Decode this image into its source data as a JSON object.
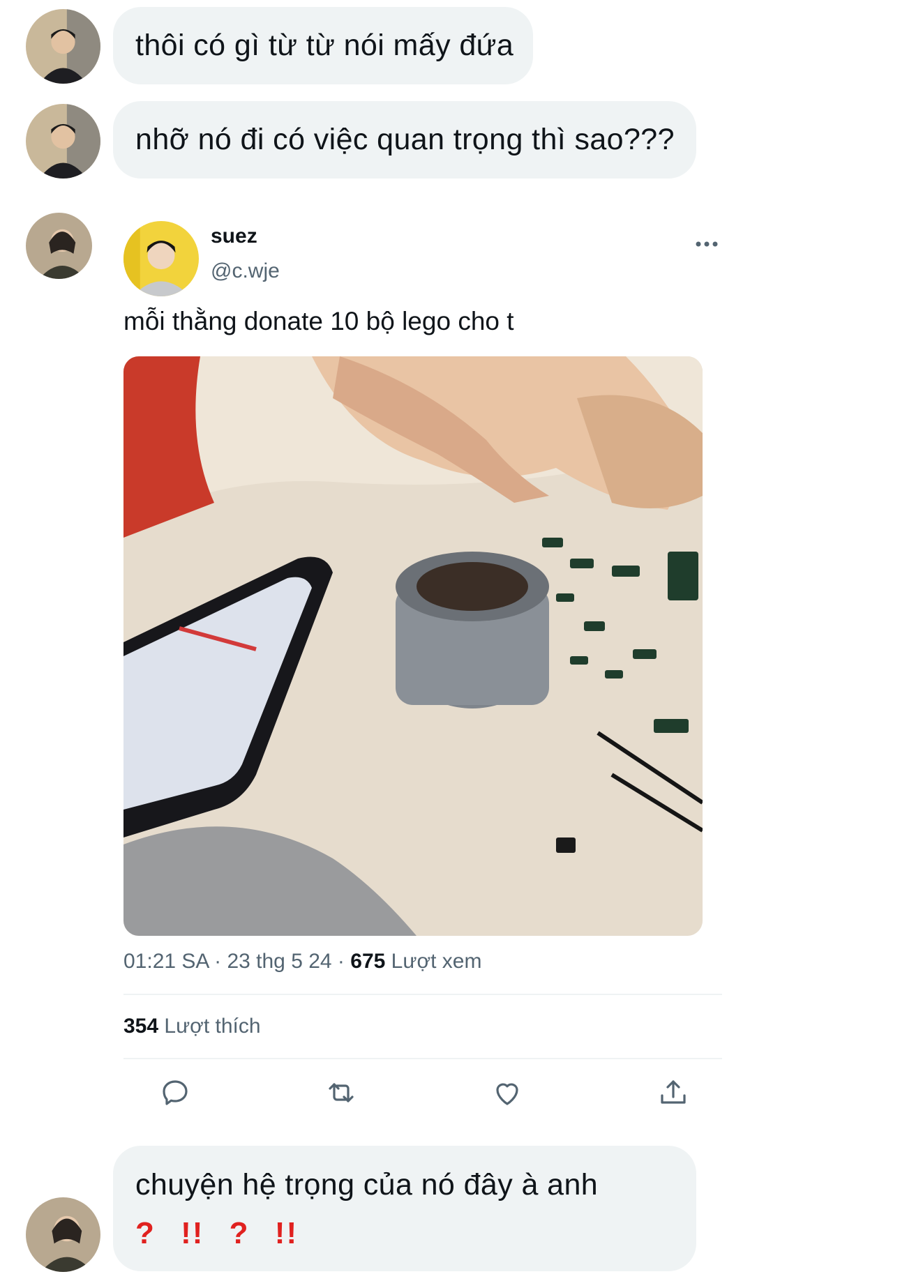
{
  "messages": [
    {
      "text": "thôi có gì từ từ nói mấy đứa"
    },
    {
      "text": "nhỡ nó đi có việc quan trọng thì sao???"
    }
  ],
  "tweet": {
    "author_name": "suez",
    "author_handle": "@c.wje",
    "text": "mỗi thằng donate 10 bộ lego cho t",
    "time": "01:21 SA",
    "date": "23 thg 5 24",
    "views_count": "675",
    "views_label": "Lượt xem",
    "likes_count": "354",
    "likes_label": "Lượt thích",
    "media_icon": "lego-build-photo",
    "actions": [
      "reply-icon",
      "retweet-icon",
      "like-icon",
      "share-icon"
    ]
  },
  "reply": {
    "text": "chuyện hệ trọng của nó đây à anh",
    "emoji": [
      "?",
      "!!",
      "?",
      "!!"
    ]
  },
  "colors": {
    "bubble_bg": "#eff3f4",
    "secondary_text": "#536471",
    "emoji_red": "#e0211f"
  }
}
